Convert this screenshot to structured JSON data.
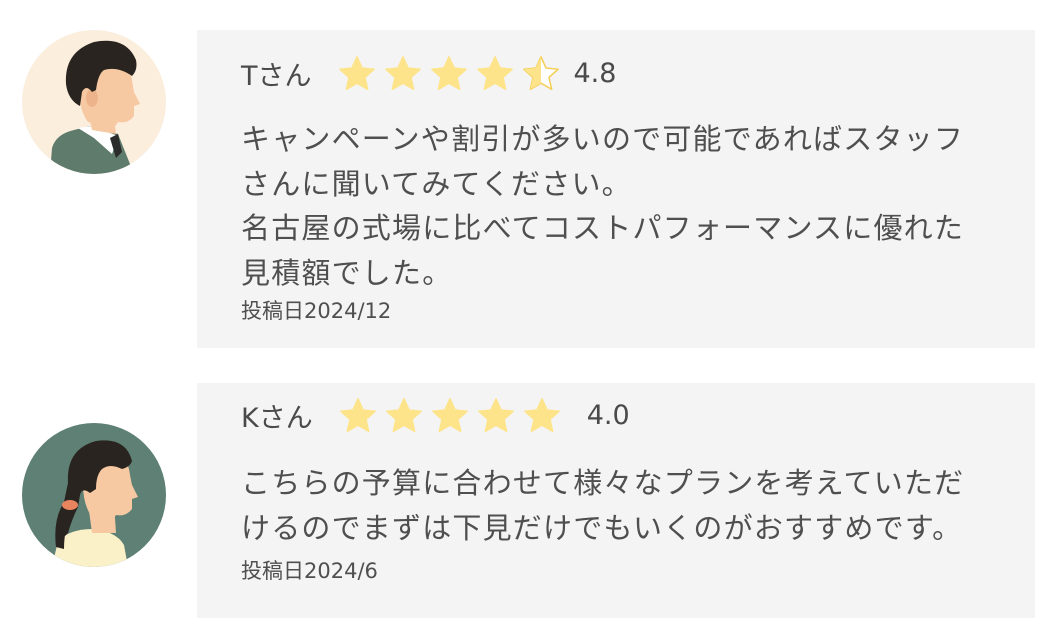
{
  "reviews": [
    {
      "name": "Tさん",
      "rating_value": 4.8,
      "rating_text": "4.8",
      "body_lines": [
        "キャンペーンや割引が多いので可能であればスタッフ",
        "さんに聞いてみてください。",
        "名古屋の式場に比べてコストパフォーマンスに優れた",
        "見積額でした。"
      ],
      "date": "投稿日2024/12",
      "avatar": "man-avatar-icon"
    },
    {
      "name": "Kさん",
      "rating_value": 5,
      "rating_text": "4.0",
      "body_lines": [
        "こちらの予算に合わせて様々なプランを考えていただ",
        "けるのでまずは下見だけでもいくのがおすすめです。"
      ],
      "date": "投稿日2024/6",
      "avatar": "woman-avatar-icon"
    }
  ],
  "colors": {
    "card_background": "#f4f4f4",
    "star_fill": "#fde48a",
    "star_empty": "#ffffff",
    "star_outline": "#f4cf5a",
    "text": "#4a4a4a"
  }
}
